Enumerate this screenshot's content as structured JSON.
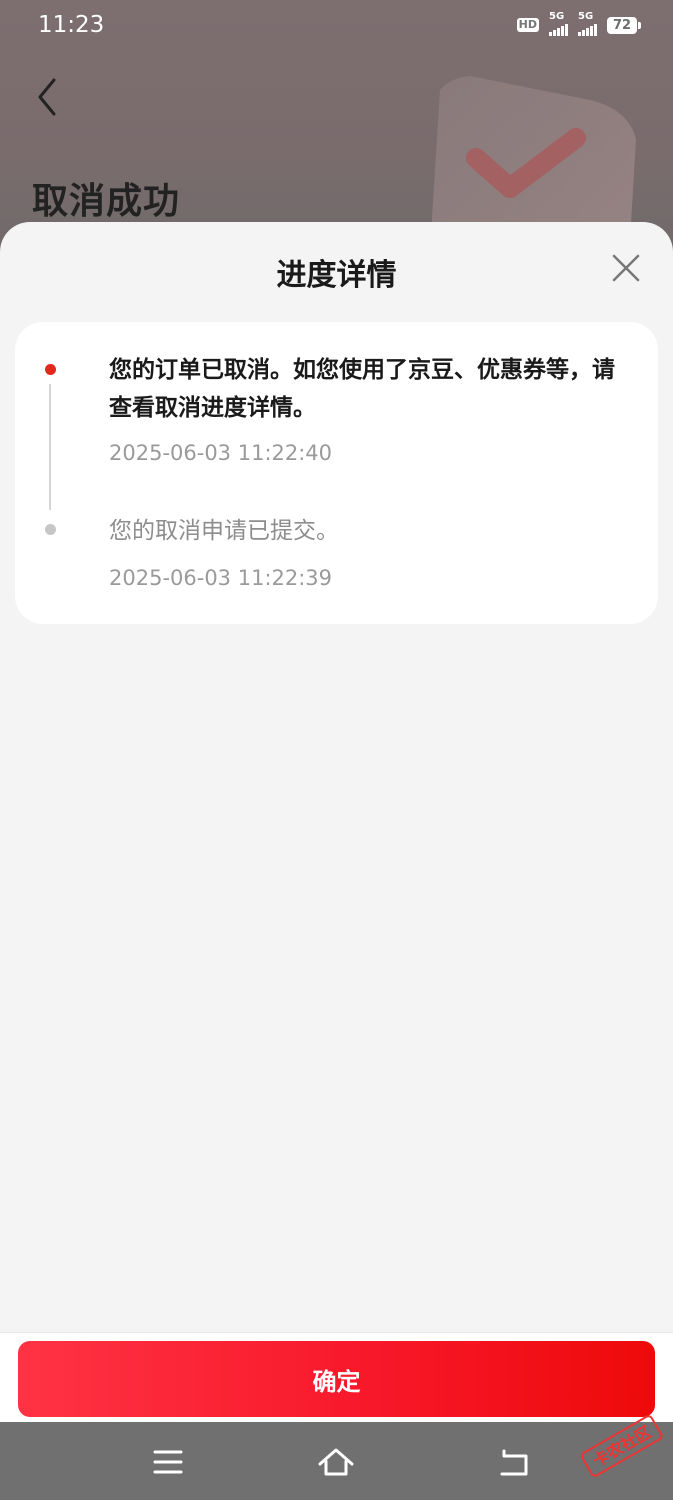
{
  "status_bar": {
    "time": "11:23",
    "hd_label": "HD",
    "network_1": "5G",
    "network_2": "5G",
    "battery": "72"
  },
  "background_page": {
    "title": "取消成功"
  },
  "sheet": {
    "title": "进度详情",
    "events": [
      {
        "text": "您的订单已取消。如您使用了京豆、优惠券等，请查看取消进度详情。",
        "time": "2025-06-03 11:22:40",
        "status": "current"
      },
      {
        "text": "您的取消申请已提交。",
        "time": "2025-06-03 11:22:39",
        "status": "past"
      }
    ],
    "confirm_label": "确定"
  },
  "colors": {
    "accent": "#e3281c",
    "button_gradient_start": "#ff3344",
    "button_gradient_end": "#ee0a0a"
  },
  "icons": {
    "back": "chevron-left-icon",
    "close": "close-icon",
    "nav_menu": "menu-icon",
    "nav_home": "home-icon",
    "nav_back": "back-icon"
  }
}
